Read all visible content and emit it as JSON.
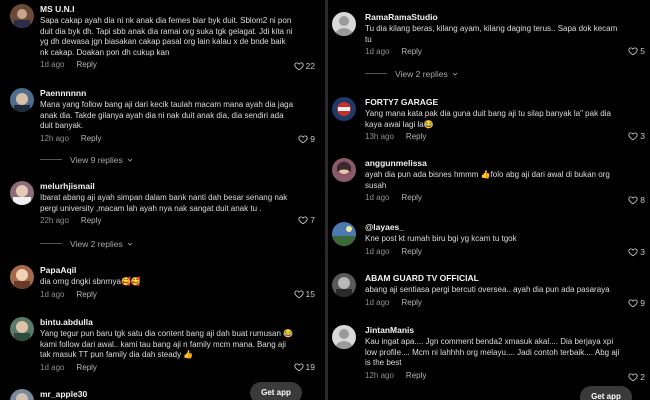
{
  "left_comments": [
    {
      "username": "MS U.N.I",
      "text": "Sapa cakap ayah dia ni nk anak dia femes biar byk duit. Sblom2 ni pon duit dia byk dh. Tapi sbb anak dia ramai org suka tgk gelagat. Jdi kita ni yg dh dewasa jgn biasakan cakap pasal org lain kalau x de bnde baik nk cakap. Doakan pon dh cukup kan",
      "time": "1d ago",
      "reply": "Reply",
      "likes": "22"
    },
    {
      "username": "Paennnnnn",
      "text": "Mana yang follow bang aji dari kecik taulah macam mana ayah dia jaga anak dia. Takde gilanya ayah dia ni nak duit anak dia, dia sendiri ada duit banyak.",
      "time": "12h ago",
      "reply": "Reply",
      "likes": "9"
    },
    {
      "username": "melurhjismail",
      "text": "Ibarat abang aji ayah simpan dalam bank nanti dah besar senang nak pergi university ,macam lah ayah nya nak sangat duit anak tu .",
      "time": "22h ago",
      "reply": "Reply",
      "likes": "7"
    },
    {
      "username": "PapaAqil",
      "text": "dia orng dngki sbnrnya🥰🥰",
      "time": "1d ago",
      "reply": "Reply",
      "likes": "15"
    },
    {
      "username": "bintu.abdulla",
      "text": "Yang tegur pun baru tgk satu dia content bang aji dah buat rumusan 😂 kami follow dari awal.. kami tau bang aji n family mcm mana. Bang aji tak masuk TT pun family dia dah steady 👍",
      "time": "1d ago",
      "reply": "Reply",
      "likes": "19"
    },
    {
      "username": "mr_apple30",
      "text": "",
      "time": "",
      "reply": "",
      "likes": ""
    }
  ],
  "left_view_replies": [
    "View 9 replies",
    "View 2 replies"
  ],
  "right_comments": [
    {
      "username": "RamaRamaStudio",
      "text": "Tu dia kilang beras, kilang ayam, kilang daging terus.. Sapa dok kecam tu",
      "time": "1d ago",
      "reply": "Reply",
      "likes": "5"
    },
    {
      "username": "FORTY7 GARAGE",
      "text": "Yang mana kata pak dia guna duit bang aji tu silap banyak la\" pak dia kaya awai lagi la😂",
      "time": "13h ago",
      "reply": "Reply",
      "likes": "3"
    },
    {
      "username": "anggunmelissa",
      "text": "ayah dia pun ada bisnes hmmm 👍folo abg aji dari awal di bukan org susah",
      "time": "1d ago",
      "reply": "Reply",
      "likes": "8"
    },
    {
      "username": "@layaes_",
      "text": "Kne post kt rumah biru bgi yg kcam tu tgok",
      "time": "1d ago",
      "reply": "Reply",
      "likes": "3"
    },
    {
      "username": "ABAM GUARD TV OFFICIAL",
      "text": "abang aji sentiasa pergi bercuti oversea.. ayah dia pun ada pasaraya",
      "time": "1d ago",
      "reply": "Reply",
      "likes": "9"
    },
    {
      "username": "JintanManis",
      "text": "Kau ingat apa.... Jgn comment benda2 xmasuk akal.... Dia berjaya xpi low profile.... Mcm ni lahhhh org melayu.... Jadi contoh terbaik.... Abg aji is the best",
      "time": "12h ago",
      "reply": "Reply",
      "likes": "2"
    }
  ],
  "right_view_replies": [
    "View 2 replies"
  ],
  "get_app": "Get app",
  "colors": {
    "background": "#000000",
    "text": "#e8e8e8",
    "muted": "#8e8e8e",
    "button": "#3a3a3a"
  },
  "icons": {
    "like": "heart-outline-icon",
    "expand": "chevron-down-icon"
  }
}
